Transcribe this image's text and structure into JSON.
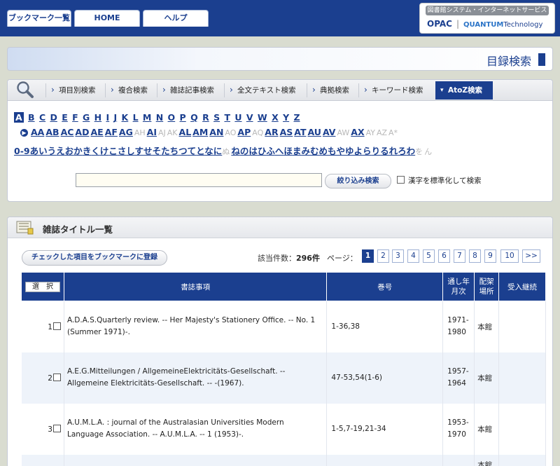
{
  "top_tabs": {
    "bookmarks": "ブックマーク一覧",
    "home": "HOME",
    "help": "ヘルプ"
  },
  "brand": {
    "subtitle": "図書館システム・インターネットサービス",
    "opac": "OPAC",
    "separator": "|",
    "quantum": "QUANTUM",
    "technology": "Technology"
  },
  "page_title": "目録検索",
  "search_nav": [
    "項目別検索",
    "複合検索",
    "雑誌記事検索",
    "全文テキスト検索",
    "典拠検索",
    "キーワード検索"
  ],
  "search_nav_active": "AtoZ検索",
  "letters": [
    "A",
    "B",
    "C",
    "D",
    "E",
    "F",
    "G",
    "H",
    "I",
    "J",
    "K",
    "L",
    "M",
    "N",
    "O",
    "P",
    "Q",
    "R",
    "S",
    "T",
    "U",
    "V",
    "W",
    "X",
    "Y",
    "Z"
  ],
  "sub_letters": [
    {
      "t": "AA",
      "on": true
    },
    {
      "t": "AB",
      "on": true
    },
    {
      "t": "AC",
      "on": true
    },
    {
      "t": "AD",
      "on": true
    },
    {
      "t": "AE",
      "on": true
    },
    {
      "t": "AF",
      "on": true
    },
    {
      "t": "AG",
      "on": true
    },
    {
      "t": "AH",
      "on": false
    },
    {
      "t": "AI",
      "on": true
    },
    {
      "t": "AJ",
      "on": false
    },
    {
      "t": "AK",
      "on": false
    },
    {
      "t": "AL",
      "on": true
    },
    {
      "t": "AM",
      "on": true
    },
    {
      "t": "AN",
      "on": true
    },
    {
      "t": "AO",
      "on": false
    },
    {
      "t": "AP",
      "on": true
    },
    {
      "t": "AQ",
      "on": false
    },
    {
      "t": "AR",
      "on": true
    },
    {
      "t": "AS",
      "on": true
    },
    {
      "t": "AT",
      "on": true
    },
    {
      "t": "AU",
      "on": true
    },
    {
      "t": "AV",
      "on": true
    },
    {
      "t": "AW",
      "on": false
    },
    {
      "t": "AX",
      "on": true
    },
    {
      "t": "AY",
      "on": false
    },
    {
      "t": "AZ",
      "on": false
    },
    {
      "t": "A*",
      "on": false
    }
  ],
  "kana_row": [
    {
      "t": "0-9",
      "on": true
    },
    {
      "t": "あ",
      "on": true
    },
    {
      "t": "い",
      "on": true
    },
    {
      "t": "う",
      "on": true
    },
    {
      "t": "え",
      "on": true
    },
    {
      "t": "お",
      "on": true
    },
    {
      "t": "か",
      "on": true
    },
    {
      "t": "き",
      "on": true
    },
    {
      "t": "く",
      "on": true
    },
    {
      "t": "け",
      "on": true
    },
    {
      "t": "こ",
      "on": true
    },
    {
      "t": "さ",
      "on": true
    },
    {
      "t": "し",
      "on": true
    },
    {
      "t": "す",
      "on": true
    },
    {
      "t": "せ",
      "on": true
    },
    {
      "t": "そ",
      "on": true
    },
    {
      "t": "た",
      "on": true
    },
    {
      "t": "ち",
      "on": true
    },
    {
      "t": "つ",
      "on": true
    },
    {
      "t": "て",
      "on": true
    },
    {
      "t": "と",
      "on": true
    },
    {
      "t": "な",
      "on": true
    },
    {
      "t": "に",
      "on": true
    },
    {
      "t": "ぬ",
      "on": false
    },
    {
      "t": "ね",
      "on": true
    },
    {
      "t": "の",
      "on": true
    },
    {
      "t": "は",
      "on": true
    },
    {
      "t": "ひ",
      "on": true
    },
    {
      "t": "ふ",
      "on": true
    },
    {
      "t": "へ",
      "on": true
    },
    {
      "t": "ほ",
      "on": true
    },
    {
      "t": "ま",
      "on": true
    },
    {
      "t": "み",
      "on": true
    },
    {
      "t": "む",
      "on": true
    },
    {
      "t": "め",
      "on": true
    },
    {
      "t": "も",
      "on": true
    },
    {
      "t": "や",
      "on": true
    },
    {
      "t": "ゆ",
      "on": true
    },
    {
      "t": "よ",
      "on": true
    },
    {
      "t": "ら",
      "on": true
    },
    {
      "t": "り",
      "on": true
    },
    {
      "t": "る",
      "on": true
    },
    {
      "t": "れ",
      "on": true
    },
    {
      "t": "ろ",
      "on": true
    },
    {
      "t": "わ",
      "on": true
    },
    {
      "t": "を",
      "on": false
    },
    {
      "t": "ん",
      "on": false
    }
  ],
  "search": {
    "value": "",
    "filter_button": "絞り込み検索",
    "kanji_label": "漢字を標準化して検索"
  },
  "results": {
    "title": "雑誌タイトル一覧",
    "bookmark_button": "チェックした項目をブックマークに登録",
    "hits_label": "該当件数：",
    "hits_value": "296件",
    "page_label": "ページ：",
    "pages": [
      "1",
      "2",
      "3",
      "4",
      "5",
      "6",
      "7",
      "8",
      "9",
      "10",
      ">>"
    ],
    "headers": {
      "select": "選　択",
      "bib": "書誌事項",
      "volume": "巻号",
      "years_1": "通し年",
      "years_2": "月次",
      "location_1": "配架",
      "location_2": "場所",
      "receipt": "受入継続"
    },
    "rows": [
      {
        "num": "1",
        "bib_1": "A.D.A.S.Quarterly review. -- Her Majesty's Stationery Office. -- No. 1",
        "bib_2": "(Summer 1971)-.",
        "volume": "1-36,38",
        "years_1": "1971-",
        "years_2": "1980",
        "location": "本館"
      },
      {
        "num": "2",
        "bib_1": "A.E.G.Mitteilungen / AllgemeineElektricitäts-Gesellschaft. --",
        "bib_2": "Allgemeine Elektricitäts-Gesellschaft. -- -(1967).",
        "volume": "47-53,54(1-6)",
        "years_1": "1957-",
        "years_2": "1964",
        "location": "本館"
      },
      {
        "num": "3",
        "bib_1": "A.U.M.L.A. : journal of the Australasian Universities Modern",
        "bib_2": "Language Association. -- A.U.M.L.A. -- 1 (1953)-.",
        "volume": "1-5,7-19,21-34",
        "years_1": "1953-",
        "years_2": "1970",
        "location": "本館"
      },
      {
        "num": "",
        "bib_1": "",
        "bib_2": "",
        "volume": "",
        "years_1": "",
        "years_2": "",
        "location": "本館"
      }
    ]
  }
}
